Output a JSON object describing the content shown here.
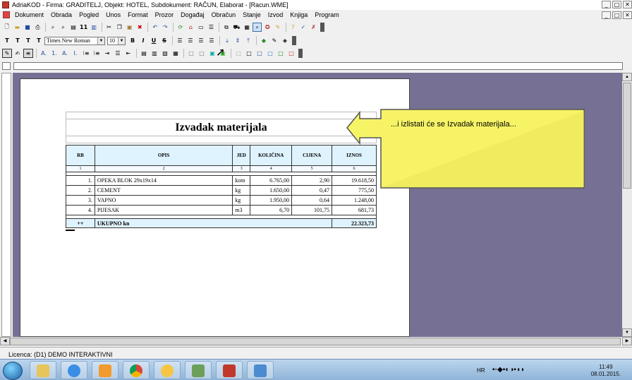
{
  "window": {
    "title": "AdriaKOD - Firma: GRADITELJ,   Objekt: HOTEL,   Subdokument: RAČUN,  Elaborat - [Racun.WME]",
    "minimize": "_",
    "maximize": "□",
    "close": "✕"
  },
  "menu": [
    "Dokument",
    "Obrada",
    "Pogled",
    "Unos",
    "Format",
    "Prozor",
    "Događaj",
    "Obračun",
    "Stanje",
    "Izvod",
    "Knjiga",
    "Program"
  ],
  "toolbar2": {
    "font": "Times New Roman",
    "size": "10"
  },
  "document": {
    "title": "Izvadak materijala",
    "headers": [
      "RB",
      "OPIS",
      "JED",
      "KOLIČINA",
      "CIJENA",
      "IZNOS"
    ],
    "col_numbers": [
      "1",
      "2",
      "3",
      "4",
      "5",
      "6"
    ],
    "rows": [
      {
        "rb": "1.",
        "opis": "OPEKA BLOK 29x19x14",
        "jed": "kom",
        "kolicina": "6.765,00",
        "cijena": "2,90",
        "iznos": "19.618,50"
      },
      {
        "rb": "2.",
        "opis": "CEMENT",
        "jed": "kg",
        "kolicina": "1.650,00",
        "cijena": "0,47",
        "iznos": "775,50"
      },
      {
        "rb": "3.",
        "opis": "VAPNO",
        "jed": "kg",
        "kolicina": "1.950,00",
        "cijena": "0,64",
        "iznos": "1.248,00"
      },
      {
        "rb": "4.",
        "opis": "PIJESAK",
        "jed": "m3",
        "kolicina": "6,70",
        "cijena": "101,75",
        "iznos": "681,73"
      }
    ],
    "total": {
      "marker": "++",
      "label": "UKUPNO kn",
      "value": "22.323,73"
    }
  },
  "callout": {
    "text": "...i izlistati će se Izvadak materijala..."
  },
  "status": {
    "licence": "Licenca:  (D1) DEMO INTERAKTIVNI"
  },
  "taskbar": {
    "language": "HR",
    "time": "11:49",
    "date": "08.01.2015."
  },
  "colors": {
    "workspace": "#767094",
    "callout_fill": "#f6f466",
    "table_header": "#dff3ff"
  }
}
